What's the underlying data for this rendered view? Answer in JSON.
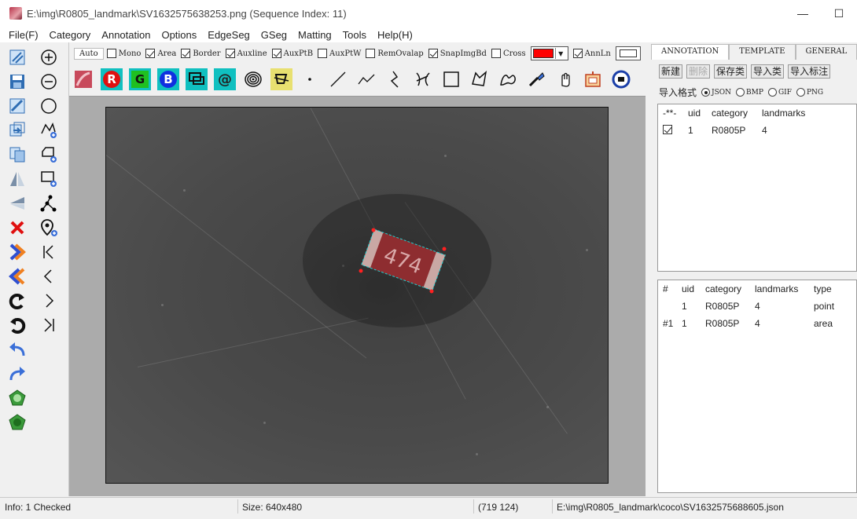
{
  "window": {
    "title": "E:\\img\\R0805_landmark\\SV1632575638253.png (Sequence Index: 11)",
    "minimize": "—",
    "maximize": "☐"
  },
  "menu": [
    "File(F)",
    "Category",
    "Annotation",
    "Options",
    "EdgeSeg",
    "GSeg",
    "Matting",
    "Tools",
    "Help(H)"
  ],
  "options": {
    "auto_label": "Auto",
    "mono": "Mono",
    "area": "Area",
    "border": "Border",
    "auxline": "Auxline",
    "auxptb": "AuxPtB",
    "auxptw": "AuxPtW",
    "removalap": "RemOvalap",
    "snapimgbd": "SnapImgBd",
    "cross": "Cross",
    "annln": "AnnLn",
    "color_accent": "#ff0000"
  },
  "strip": {
    "r": "R",
    "g": "G",
    "b": "B",
    "at": "@"
  },
  "image": {
    "chip_text": "474"
  },
  "right": {
    "tabs": [
      "ANNOTATION",
      "TEMPLATE",
      "GENERAL"
    ],
    "buttons": [
      "新建",
      "删除",
      "保存类",
      "导入类",
      "导入标注"
    ],
    "import_label": "导入格式",
    "formats": [
      "JSON",
      "BMP",
      "GIF",
      "PNG"
    ],
    "table1": {
      "headers": [
        "-**-",
        "uid",
        "category",
        "landmarks"
      ],
      "rows": [
        {
          "uid": "1",
          "category": "R0805P",
          "landmarks": "4"
        }
      ]
    },
    "table2": {
      "headers": [
        "#",
        "uid",
        "category",
        "landmarks",
        "type"
      ],
      "rows": [
        {
          "idx": "",
          "uid": "1",
          "category": "R0805P",
          "landmarks": "4",
          "type": "point"
        },
        {
          "idx": "#1",
          "uid": "1",
          "category": "R0805P",
          "landmarks": "4",
          "type": "area"
        }
      ]
    }
  },
  "status": {
    "info": "Info: 1 Checked",
    "size": "Size: 640x480",
    "coords": "(719  124)",
    "path": "E:\\img\\R0805_landmark\\coco\\SV1632575688605.json"
  }
}
